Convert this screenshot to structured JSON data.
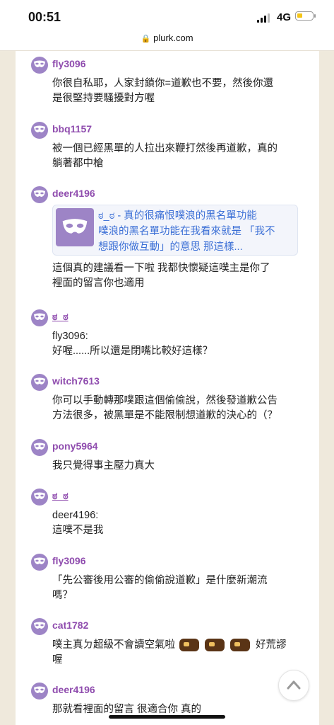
{
  "status": {
    "time": "00:51",
    "network": "4G"
  },
  "browser": {
    "url": "plurk.com"
  },
  "responses": [
    {
      "user": "fly3096",
      "lines": [
        "你很自私耶，人家封鎖你=道歉也不要，然後你還",
        "是很堅持要騷擾對方喔"
      ]
    },
    {
      "user": "bbq1157",
      "lines": [
        "被一個已經黑單的人拉出來鞭打然後再道歉，真的",
        "躺著都中槍"
      ]
    },
    {
      "user": "deer4196",
      "link_lines": [
        "ಠ_ಠ - 真的很痛恨噗浪的黑名單功能",
        "噗浪的黑名單功能在我看來就是 「我不",
        "想跟你做互動」的意思 那這樣..."
      ],
      "lines": [
        "這個真的建議看一下啦 我都快懷疑這噗主是你了",
        "裡面的留言你也適用"
      ]
    },
    {
      "user": "ಠ_ಠ",
      "lines": [
        "fly3096:",
        "好喔......所以還是閉嘴比較好這樣？"
      ]
    },
    {
      "user": "witch7613",
      "lines": [
        "你可以手動轉那噗跟這個偷偷說，然後發道歉公告",
        "方法很多，被黑單是不能限制想道歉的決心的（？"
      ]
    },
    {
      "user": "pony5964",
      "lines": [
        "我只覺得事主壓力真大"
      ]
    },
    {
      "user": "ಠ_ಠ",
      "lines": [
        "deer4196:",
        "這噗不是我"
      ]
    },
    {
      "user": "fly3096",
      "lines": [
        "「先公審後用公審的偷偷說道歉」是什麼新潮流",
        "嗎？"
      ]
    },
    {
      "user": "cat1782",
      "lines": [
        "噗主真ㄉ超級不會讀空氣啦",
        "喔"
      ],
      "trail_text": "好荒謬"
    },
    {
      "user": "deer4196",
      "lines": [
        "那就看裡面的留言 很適合你 真的"
      ]
    }
  ]
}
